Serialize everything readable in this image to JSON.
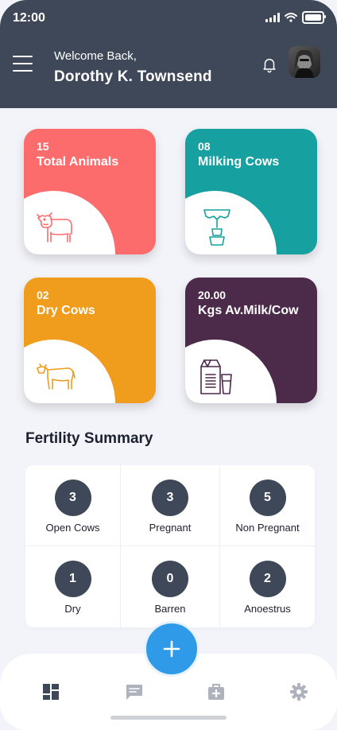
{
  "status_bar": {
    "time": "12:00"
  },
  "header": {
    "welcome": "Welcome Back,",
    "user_name": "Dorothy K. Townsend"
  },
  "cards": [
    {
      "count": "15",
      "label": "Total Animals",
      "color": "#fc6c6d",
      "icon": "cow-icon"
    },
    {
      "count": "08",
      "label": "Milking Cows",
      "color": "#16a09f",
      "icon": "milk-pump-icon"
    },
    {
      "count": "02",
      "label": "Dry Cows",
      "color": "#f09c1c",
      "icon": "dry-cow-icon"
    },
    {
      "count": "20.00",
      "label": "Kgs Av.Milk/Cow",
      "color": "#4b2a4a",
      "icon": "milk-carton-icon"
    }
  ],
  "fertility": {
    "title": "Fertility Summary",
    "items": [
      {
        "value": "3",
        "label": "Open Cows"
      },
      {
        "value": "3",
        "label": "Pregnant"
      },
      {
        "value": "5",
        "label": "Non Pregnant"
      },
      {
        "value": "1",
        "label": "Dry"
      },
      {
        "value": "0",
        "label": "Barren"
      },
      {
        "value": "2",
        "label": "Anoestrus"
      }
    ]
  },
  "bottom_nav": {
    "items": [
      "dashboard-icon",
      "messages-icon",
      "health-kit-icon",
      "settings-icon"
    ],
    "active": "dashboard-icon"
  },
  "colors": {
    "header": "#3f4858",
    "accent": "#2f9be8",
    "circle": "#3f4858"
  }
}
